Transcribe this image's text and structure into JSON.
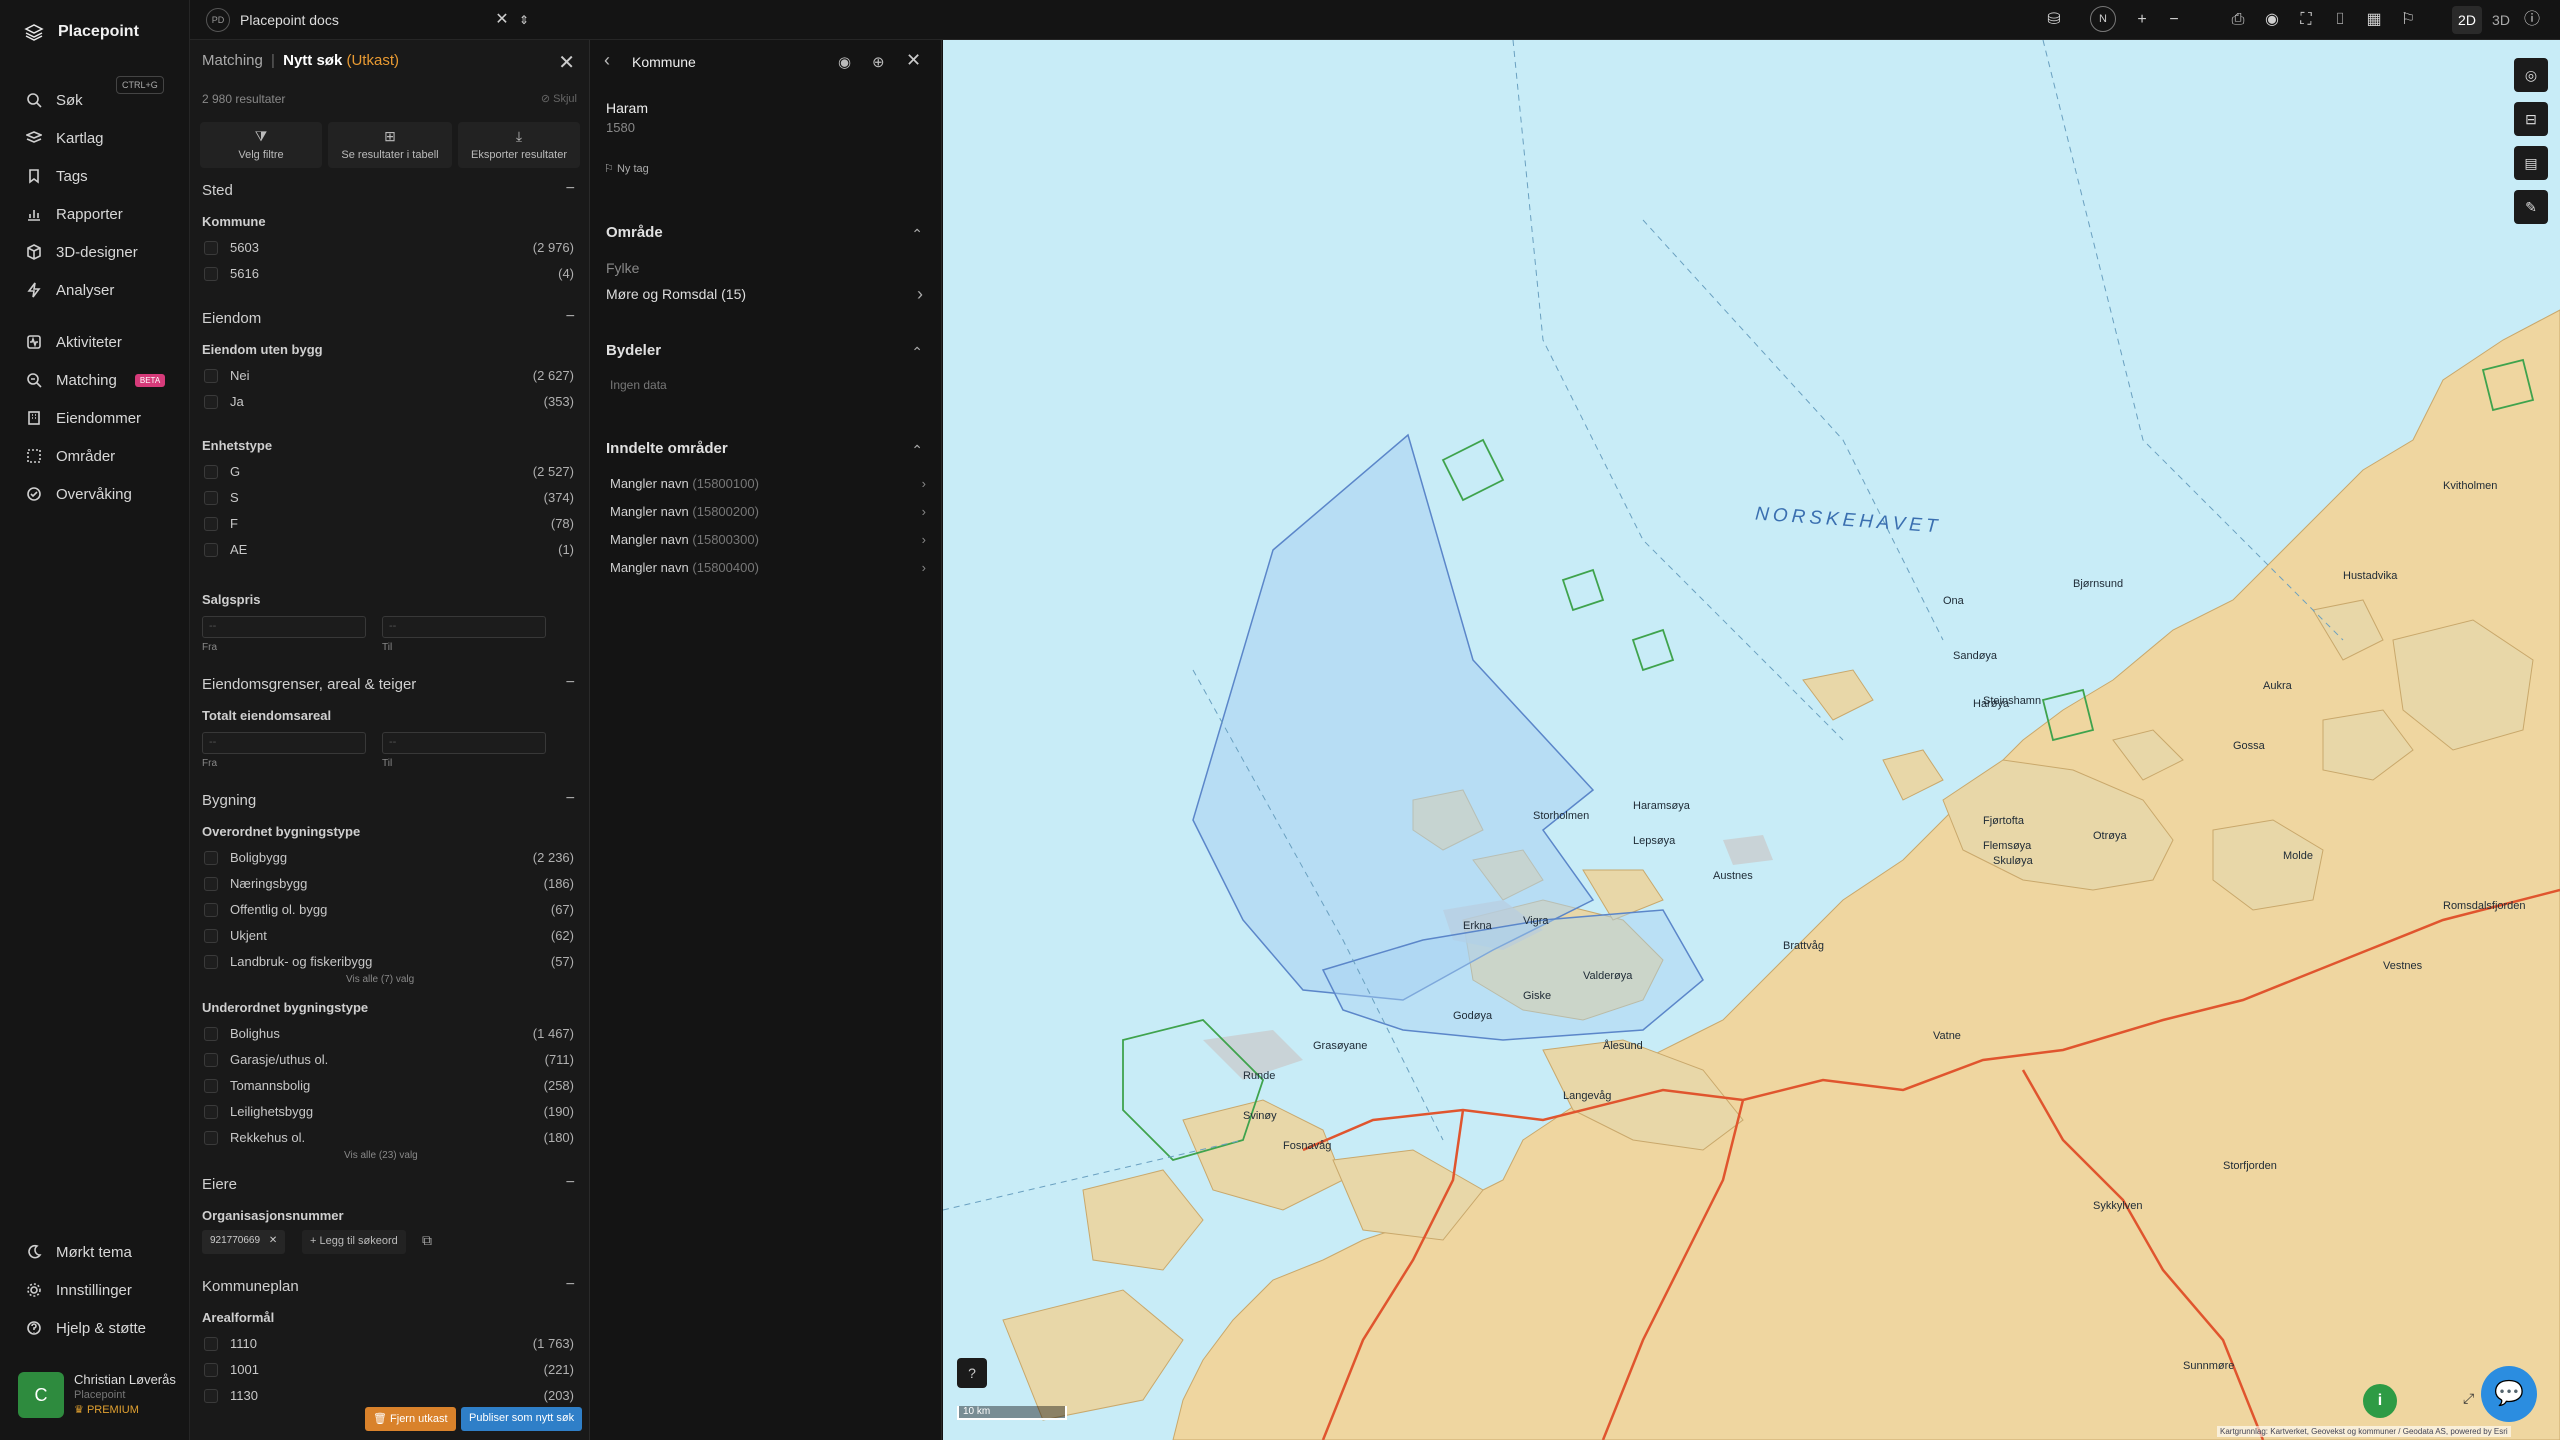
{
  "app": {
    "name": "Placepoint"
  },
  "sidebar": {
    "search_shortcut": "CTRL+G",
    "items": [
      {
        "label": "Søk",
        "icon": "search-icon"
      },
      {
        "label": "Kartlag",
        "icon": "layers-icon"
      },
      {
        "label": "Tags",
        "icon": "bookmark-icon"
      },
      {
        "label": "Rapporter",
        "icon": "chart-icon"
      },
      {
        "label": "3D-designer",
        "icon": "cube-icon"
      },
      {
        "label": "Analyser",
        "icon": "bolt-icon"
      },
      {
        "label": "Aktiviteter",
        "icon": "activity-icon"
      },
      {
        "label": "Matching",
        "icon": "match-icon",
        "badge": "BETA"
      },
      {
        "label": "Eiendommer",
        "icon": "building-icon"
      },
      {
        "label": "Områder",
        "icon": "area-icon"
      },
      {
        "label": "Overvåking",
        "icon": "watch-icon"
      }
    ],
    "bottom": [
      {
        "label": "Mørkt tema",
        "icon": "moon-icon"
      },
      {
        "label": "Innstillinger",
        "icon": "gear-icon"
      },
      {
        "label": "Hjelp & støtte",
        "icon": "help-icon"
      }
    ],
    "user": {
      "initial": "C",
      "name": "Christian Løverås",
      "org": "Placepoint",
      "plan": "PREMIUM"
    }
  },
  "topbar": {
    "doc_initials": "PD",
    "doc_title": "Placepoint docs",
    "compass": "N",
    "mode_2d": "2D",
    "mode_3d": "3D"
  },
  "filter": {
    "breadcrumb_root": "Matching",
    "separator": "|",
    "title": "Nytt søk",
    "status": "(Utkast)",
    "results": "2 980 resultater",
    "hide": "Skjul",
    "actions": [
      "Velg filtre",
      "Se resultater i tabell",
      "Eksporter resultater"
    ],
    "sted": {
      "heading": "Sted",
      "kommune_label": "Kommune",
      "kommune": [
        {
          "label": "5603",
          "count": "(2 976)"
        },
        {
          "label": "5616",
          "count": "(4)"
        }
      ]
    },
    "eiendom": {
      "heading": "Eiendom",
      "uten_bygg_label": "Eiendom uten bygg",
      "uten_bygg": [
        {
          "label": "Nei",
          "count": "(2 627)"
        },
        {
          "label": "Ja",
          "count": "(353)"
        }
      ],
      "enhetstype_label": "Enhetstype",
      "enhetstype": [
        {
          "label": "G",
          "count": "(2 527)"
        },
        {
          "label": "S",
          "count": "(374)"
        },
        {
          "label": "F",
          "count": "(78)"
        },
        {
          "label": "AE",
          "count": "(1)"
        }
      ],
      "salgspris_label": "Salgspris",
      "fra": "Fra",
      "til": "Til",
      "dash": "--"
    },
    "grenser": {
      "heading": "Eiendomsgrenser, areal & teiger",
      "areal_label": "Totalt eiendomsareal",
      "fra": "Fra",
      "til": "Til",
      "dash": "--"
    },
    "bygning": {
      "heading": "Bygning",
      "over_label": "Overordnet bygningstype",
      "over": [
        {
          "label": "Boligbygg",
          "count": "(2 236)"
        },
        {
          "label": "Næringsbygg",
          "count": "(186)"
        },
        {
          "label": "Offentlig ol. bygg",
          "count": "(67)"
        },
        {
          "label": "Ukjent",
          "count": "(62)"
        },
        {
          "label": "Landbruk- og fiskeribygg",
          "count": "(57)"
        }
      ],
      "over_showall": "Vis alle (7) valg",
      "under_label": "Underordnet bygningstype",
      "under": [
        {
          "label": "Bolighus",
          "count": "(1 467)"
        },
        {
          "label": "Garasje/uthus ol.",
          "count": "(711)"
        },
        {
          "label": "Tomannsbolig",
          "count": "(258)"
        },
        {
          "label": "Leilighetsbygg",
          "count": "(190)"
        },
        {
          "label": "Rekkehus ol.",
          "count": "(180)"
        }
      ],
      "under_showall": "Vis alle (23) valg"
    },
    "eiere": {
      "heading": "Eiere",
      "org_label": "Organisasjonsnummer",
      "chip": "921770669",
      "add_keyword": "Legg til søkeord"
    },
    "kommuneplan": {
      "heading": "Kommuneplan",
      "arealformal_label": "Arealformål",
      "items": [
        {
          "label": "1110",
          "count": "(1 763)"
        },
        {
          "label": "1001",
          "count": "(221)"
        },
        {
          "label": "1130",
          "count": "(203)"
        }
      ]
    },
    "footer": {
      "remove_draft": "Fjern utkast",
      "publish": "Publiser som nytt søk"
    }
  },
  "kommune_panel": {
    "title": "Kommune",
    "name": "Haram",
    "number": "1580",
    "new_tag": "Ny tag",
    "omrade_heading": "Område",
    "fylke_label": "Fylke",
    "fylke_value": "Møre og Romsdal (15)",
    "bydeler_heading": "Bydeler",
    "bydeler_empty": "Ingen data",
    "inndelte_heading": "Inndelte områder",
    "inndelte": [
      {
        "name": "Mangler navn",
        "code": "(15800100)"
      },
      {
        "name": "Mangler navn",
        "code": "(15800200)"
      },
      {
        "name": "Mangler navn",
        "code": "(15800300)"
      },
      {
        "name": "Mangler navn",
        "code": "(15800400)"
      }
    ]
  },
  "map": {
    "sea_label": "NORSKEHAVET",
    "scale": "10 km",
    "attribution": "Kartgrunnlag: Kartverket, Geovekst og kommuner / Geodata AS, powered by Esri",
    "places": [
      {
        "name": "Ona"
      },
      {
        "name": "Bjørnsund"
      },
      {
        "name": "Sandøya"
      },
      {
        "name": "Steinshamn"
      },
      {
        "name": "Harøya"
      },
      {
        "name": "Fjørtofta"
      },
      {
        "name": "Flemsøya"
      },
      {
        "name": "Skuløya"
      },
      {
        "name": "Lepsøya"
      },
      {
        "name": "Haramsøya"
      },
      {
        "name": "Austnes"
      },
      {
        "name": "Storholmen"
      },
      {
        "name": "Erkna"
      },
      {
        "name": "Vigra"
      },
      {
        "name": "Valderøya"
      },
      {
        "name": "Ålesund"
      },
      {
        "name": "Brattvåg"
      },
      {
        "name": "Vatne"
      },
      {
        "name": "Otrøya"
      },
      {
        "name": "Molde"
      },
      {
        "name": "Godøya"
      },
      {
        "name": "Giske"
      },
      {
        "name": "Runde"
      },
      {
        "name": "Grasøyane"
      },
      {
        "name": "Svinøy"
      },
      {
        "name": "Fosnavåg"
      },
      {
        "name": "Langevåg"
      },
      {
        "name": "Sykkylven"
      },
      {
        "name": "Storfjorden"
      },
      {
        "name": "Sunnmøre"
      },
      {
        "name": "Vestnes"
      },
      {
        "name": "Romsdalsfjorden"
      },
      {
        "name": "Aukra"
      },
      {
        "name": "Gossa"
      },
      {
        "name": "Kvitholmen"
      },
      {
        "name": "Hustadvika"
      }
    ]
  }
}
